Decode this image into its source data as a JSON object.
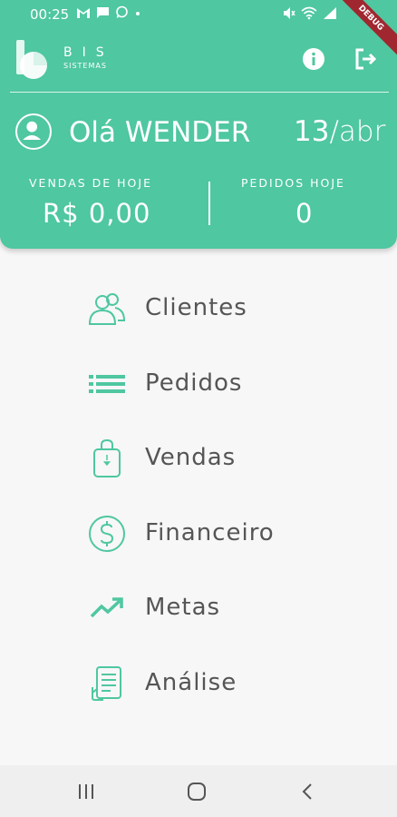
{
  "status_bar": {
    "time": "00:25",
    "debug_banner": "DEBUG"
  },
  "header": {
    "brand_name": "BIS",
    "brand_sub": "SISTEMAS",
    "greeting": "Olá WENDER",
    "date_day": "13",
    "date_month": "/abr",
    "stats": {
      "sales_label": "VENDAS DE HOJE",
      "sales_value": "R$ 0,00",
      "orders_label": "PEDIDOS HOJE",
      "orders_value": "0"
    },
    "accent_color": "#4fc7a0"
  },
  "menu": {
    "items": [
      {
        "label": "Clientes",
        "icon": "users-icon"
      },
      {
        "label": "Pedidos",
        "icon": "list-icon"
      },
      {
        "label": "Vendas",
        "icon": "shopping-bag-icon"
      },
      {
        "label": "Financeiro",
        "icon": "dollar-circle-icon"
      },
      {
        "label": "Metas",
        "icon": "trending-up-icon"
      },
      {
        "label": "Análise",
        "icon": "report-icon"
      }
    ]
  }
}
